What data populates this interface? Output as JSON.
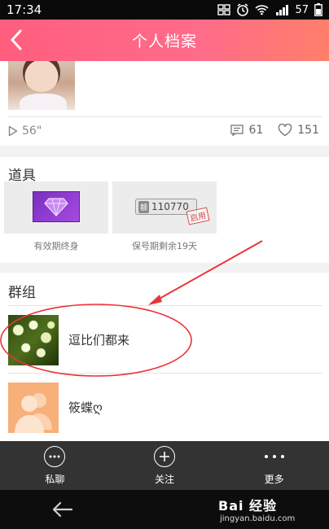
{
  "status_bar": {
    "time": "17:34",
    "battery": "57"
  },
  "header": {
    "title": "个人档案"
  },
  "profile": {
    "duration": "56\"",
    "comment_count": "61",
    "like_count": "151"
  },
  "props": {
    "title": "道具",
    "items": [
      {
        "caption": "有效期终身"
      },
      {
        "caption": "保号期剩余19天",
        "ticket_label": "靓",
        "ticket_number": "110770",
        "stamp": "启用"
      }
    ]
  },
  "groups": {
    "title": "群组",
    "items": [
      {
        "name": "逗比们都来"
      },
      {
        "name": "筱蝶ღ"
      }
    ]
  },
  "tab_bar": {
    "items": [
      {
        "label": "私聊",
        "icon": "chat-bubble-icon"
      },
      {
        "label": "关注",
        "icon": "plus-circle-icon"
      },
      {
        "label": "更多",
        "icon": "more-dots-icon"
      }
    ]
  },
  "watermark": {
    "brand": "Bai 经验",
    "url": "jingyan.baidu.com"
  },
  "colors": {
    "header_start": "#ff5e7e",
    "header_end": "#ff7f6a",
    "annotation": "#e8343a",
    "tab_bar": "#333333"
  }
}
